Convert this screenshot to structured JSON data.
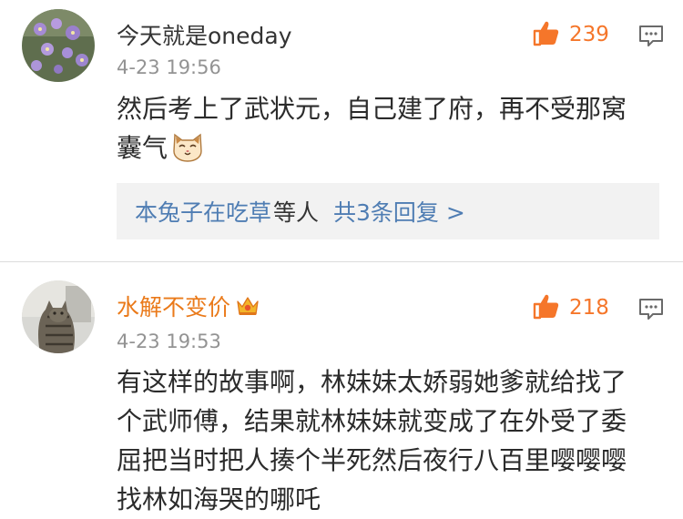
{
  "comments": [
    {
      "username": "今天就是oneday",
      "time": "4-23 19:56",
      "likes": "239",
      "text": "然后考上了武状元，自己建了府，再不受那窝囊气",
      "replies": {
        "first_replier": "本兔子在吃草",
        "connector": "等人",
        "count_label": "共3条回复 >"
      }
    },
    {
      "username": "水解不变价",
      "time": "4-23 19:53",
      "likes": "218",
      "text": "有这样的故事啊，林妹妹太娇弱她爹就给找了个武师傅，结果就林妹妹就变成了在外受了委屈把当时把人揍个半死然后夜行八百里嘤嘤嘤找林如海哭的哪吒"
    }
  ],
  "colors": {
    "like_orange": "#f5762a",
    "link_blue": "#4f7db3",
    "time_gray": "#939393",
    "reply_box_bg": "#f2f2f2"
  },
  "icons": [
    "thumbs-up-icon",
    "reply-comment-icon",
    "cat-face-emoji-icon",
    "crown-badge-icon"
  ]
}
